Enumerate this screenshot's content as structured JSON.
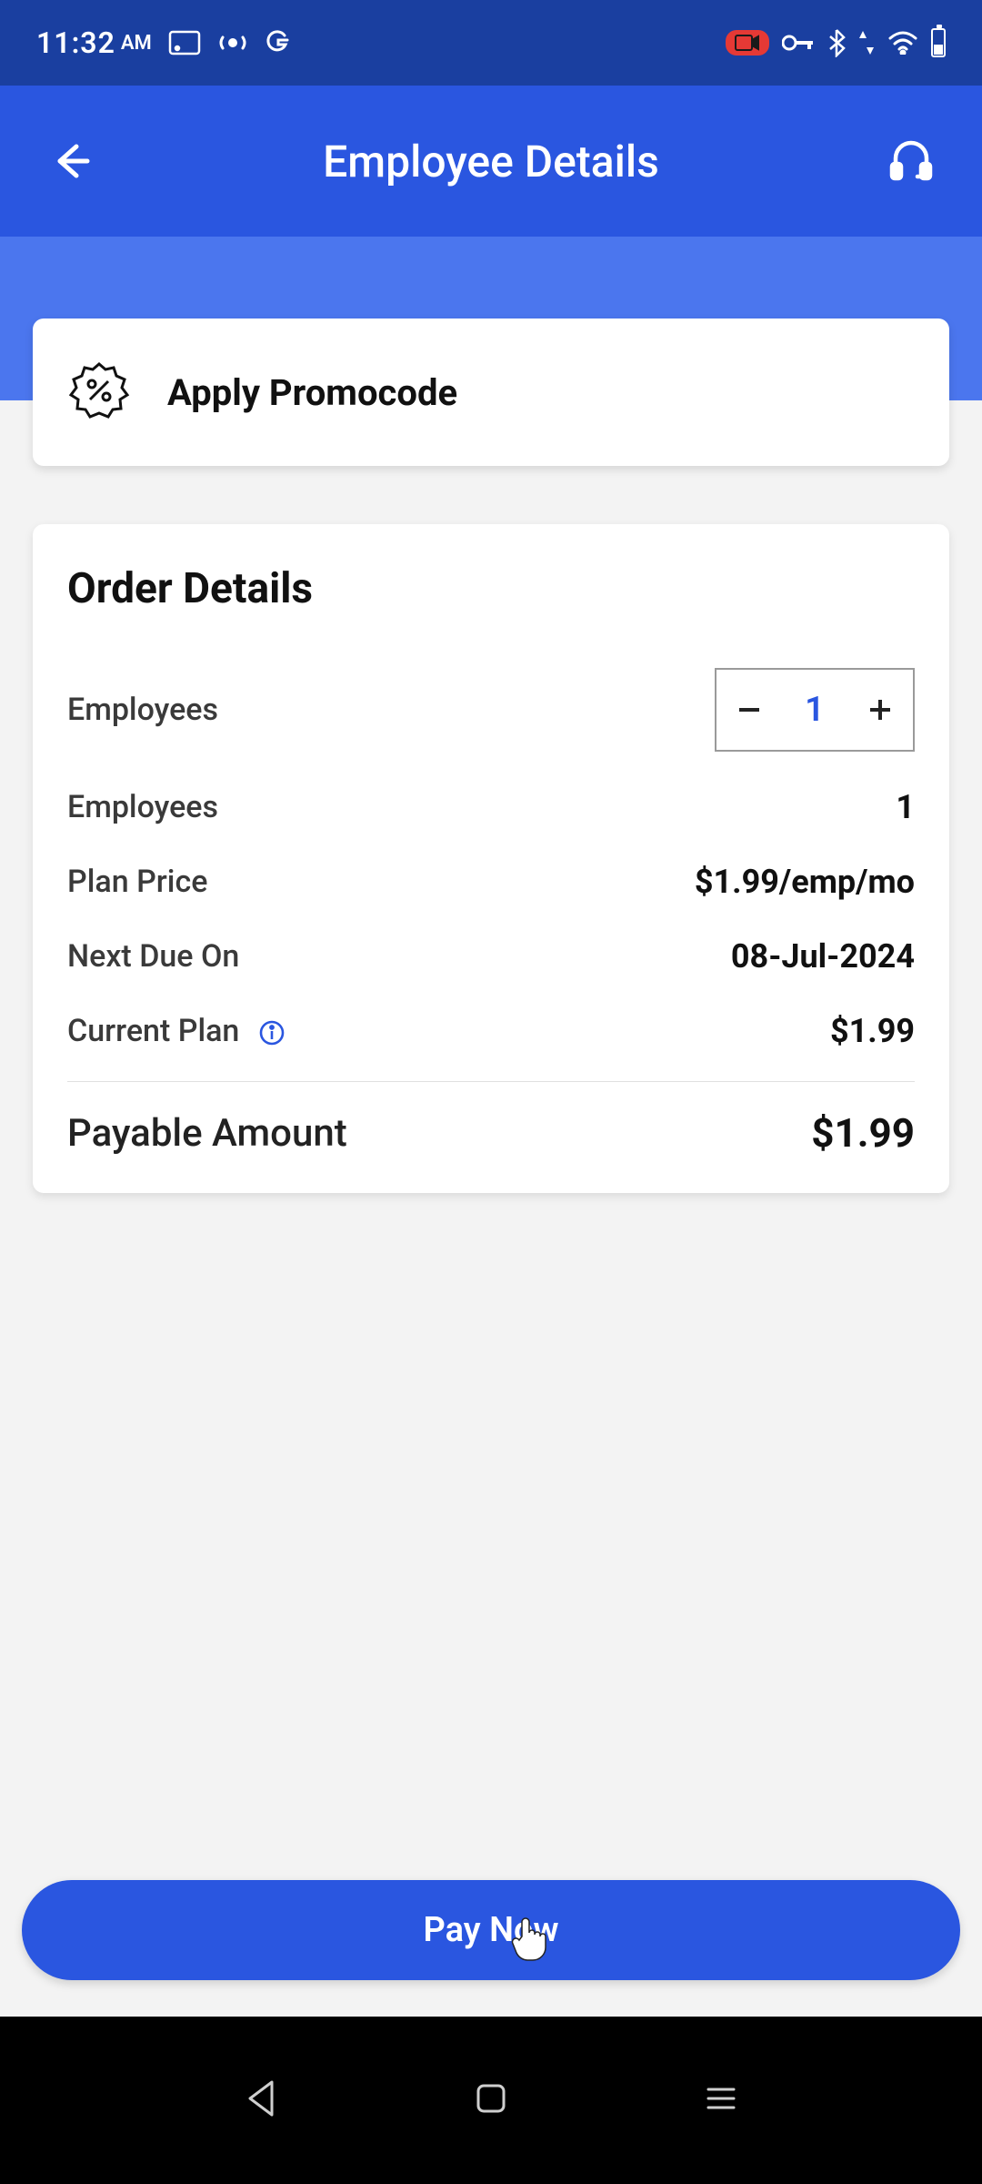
{
  "status": {
    "time": "11:32",
    "ampm": "AM"
  },
  "header": {
    "title": "Employee Details"
  },
  "promo": {
    "label": "Apply Promocode"
  },
  "order": {
    "title": "Order Details",
    "rows": {
      "employees_stepper_label": "Employees",
      "employees_stepper_value": "1",
      "employees_label": "Employees",
      "employees_value": "1",
      "plan_price_label": "Plan Price",
      "plan_price_value": "$1.99/emp/mo",
      "next_due_label": "Next Due On",
      "next_due_value": "08-Jul-2024",
      "current_plan_label": "Current Plan",
      "current_plan_value": "$1.99"
    },
    "payable": {
      "label": "Payable Amount",
      "value": "$1.99"
    }
  },
  "footer": {
    "pay_label": "Pay Now"
  },
  "colors": {
    "status_bar": "#1a3fa0",
    "app_bar": "#2a56e0",
    "blue_band": "#4b76ee",
    "accent": "#2a56e0"
  }
}
